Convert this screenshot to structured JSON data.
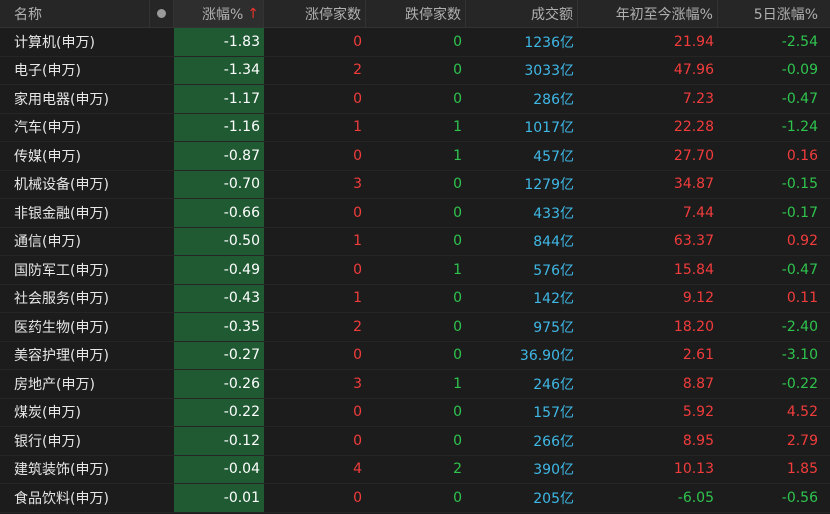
{
  "colors": {
    "up": "#f23c3c",
    "down": "#2fc44e",
    "volume": "#3fb8e6",
    "highlight_bg": "#1f5a33",
    "background": "#1c1c1c"
  },
  "header": {
    "name": "名称",
    "dot_icon": "circle-dot-icon",
    "change_pct": "涨幅%",
    "sort_icon": "↑",
    "limit_up_count": "涨停家数",
    "limit_down_count": "跌停家数",
    "turnover": "成交额",
    "ytd_change": "年初至今涨幅%",
    "five_day_change": "5日涨幅%"
  },
  "rows": [
    {
      "name": "计算机(申万)",
      "change": "-1.83",
      "up": "0",
      "down": "0",
      "turnover": "1236亿",
      "ytd": "21.94",
      "ytd_dir": "up",
      "five": "-2.54",
      "five_dir": "down"
    },
    {
      "name": "电子(申万)",
      "change": "-1.34",
      "up": "2",
      "down": "0",
      "turnover": "3033亿",
      "ytd": "47.96",
      "ytd_dir": "up",
      "five": "-0.09",
      "five_dir": "down"
    },
    {
      "name": "家用电器(申万)",
      "change": "-1.17",
      "up": "0",
      "down": "0",
      "turnover": "286亿",
      "ytd": "7.23",
      "ytd_dir": "up",
      "five": "-0.47",
      "five_dir": "down"
    },
    {
      "name": "汽车(申万)",
      "change": "-1.16",
      "up": "1",
      "down": "1",
      "turnover": "1017亿",
      "ytd": "22.28",
      "ytd_dir": "up",
      "five": "-1.24",
      "five_dir": "down"
    },
    {
      "name": "传媒(申万)",
      "change": "-0.87",
      "up": "0",
      "down": "1",
      "turnover": "457亿",
      "ytd": "27.70",
      "ytd_dir": "up",
      "five": "0.16",
      "five_dir": "up"
    },
    {
      "name": "机械设备(申万)",
      "change": "-0.70",
      "up": "3",
      "down": "0",
      "turnover": "1279亿",
      "ytd": "34.87",
      "ytd_dir": "up",
      "five": "-0.15",
      "five_dir": "down"
    },
    {
      "name": "非银金融(申万)",
      "change": "-0.66",
      "up": "0",
      "down": "0",
      "turnover": "433亿",
      "ytd": "7.44",
      "ytd_dir": "up",
      "five": "-0.17",
      "five_dir": "down"
    },
    {
      "name": "通信(申万)",
      "change": "-0.50",
      "up": "1",
      "down": "0",
      "turnover": "844亿",
      "ytd": "63.37",
      "ytd_dir": "up",
      "five": "0.92",
      "five_dir": "up"
    },
    {
      "name": "国防军工(申万)",
      "change": "-0.49",
      "up": "0",
      "down": "1",
      "turnover": "576亿",
      "ytd": "15.84",
      "ytd_dir": "up",
      "five": "-0.47",
      "five_dir": "down"
    },
    {
      "name": "社会服务(申万)",
      "change": "-0.43",
      "up": "1",
      "down": "0",
      "turnover": "142亿",
      "ytd": "9.12",
      "ytd_dir": "up",
      "five": "0.11",
      "five_dir": "up"
    },
    {
      "name": "医药生物(申万)",
      "change": "-0.35",
      "up": "2",
      "down": "0",
      "turnover": "975亿",
      "ytd": "18.20",
      "ytd_dir": "up",
      "five": "-2.40",
      "five_dir": "down"
    },
    {
      "name": "美容护理(申万)",
      "change": "-0.27",
      "up": "0",
      "down": "0",
      "turnover": "36.90亿",
      "ytd": "2.61",
      "ytd_dir": "up",
      "five": "-3.10",
      "five_dir": "down"
    },
    {
      "name": "房地产(申万)",
      "change": "-0.26",
      "up": "3",
      "down": "1",
      "turnover": "246亿",
      "ytd": "8.87",
      "ytd_dir": "up",
      "five": "-0.22",
      "five_dir": "down"
    },
    {
      "name": "煤炭(申万)",
      "change": "-0.22",
      "up": "0",
      "down": "0",
      "turnover": "157亿",
      "ytd": "5.92",
      "ytd_dir": "up",
      "five": "4.52",
      "five_dir": "up"
    },
    {
      "name": "银行(申万)",
      "change": "-0.12",
      "up": "0",
      "down": "0",
      "turnover": "266亿",
      "ytd": "8.95",
      "ytd_dir": "up",
      "five": "2.79",
      "five_dir": "up"
    },
    {
      "name": "建筑装饰(申万)",
      "change": "-0.04",
      "up": "4",
      "down": "2",
      "turnover": "390亿",
      "ytd": "10.13",
      "ytd_dir": "up",
      "five": "1.85",
      "five_dir": "up"
    },
    {
      "name": "食品饮料(申万)",
      "change": "-0.01",
      "up": "0",
      "down": "0",
      "turnover": "205亿",
      "ytd": "-6.05",
      "ytd_dir": "down",
      "five": "-0.56",
      "five_dir": "down"
    }
  ]
}
